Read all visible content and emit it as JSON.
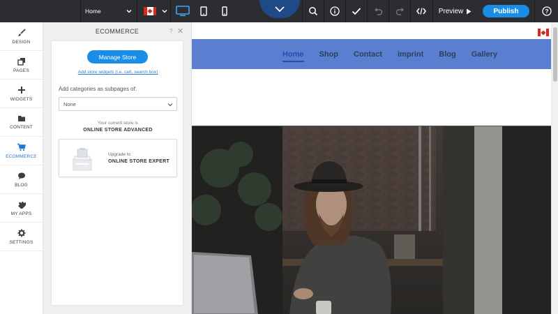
{
  "toolbar": {
    "page_select": "Home",
    "preview_label": "Preview",
    "publish_label": "Publish",
    "colors": {
      "bar": "#2b2d31",
      "accent": "#1a8ee6",
      "notch": "#1f4a86"
    },
    "icons": [
      "desktop-icon",
      "tablet-icon",
      "mobile-icon",
      "chevron-down-icon",
      "search-icon",
      "info-icon",
      "check-icon",
      "undo-icon",
      "redo-icon",
      "code-icon",
      "play-icon",
      "help-icon"
    ]
  },
  "leftnav": {
    "items": [
      {
        "label": "DESIGN",
        "icon": "brush-icon"
      },
      {
        "label": "PAGES",
        "icon": "pages-icon"
      },
      {
        "label": "WIDGETS",
        "icon": "plus-icon"
      },
      {
        "label": "CONTENT",
        "icon": "folder-icon"
      },
      {
        "label": "ECOMMERCE",
        "icon": "cart-icon",
        "active": true
      },
      {
        "label": "BLOG",
        "icon": "chat-icon"
      },
      {
        "label": "MY APPS",
        "icon": "puzzle-icon"
      },
      {
        "label": "SETTINGS",
        "icon": "gear-icon"
      }
    ]
  },
  "panel": {
    "title": "ECOMMERCE",
    "help": "?",
    "close": "✕",
    "manage_store": "Manage Store",
    "add_widgets_link": "Add store widgets (i.e. cart, search box)",
    "add_categories_label": "Add categories as subpages of:",
    "categories_select": "None",
    "current_store_label": "Your current store is",
    "current_store_value": "ONLINE STORE ADVANCED",
    "upgrade_label": "Upgrade to",
    "upgrade_value": "ONLINE STORE EXPERT"
  },
  "site": {
    "nav": [
      "Home",
      "Shop",
      "Contact",
      "imprint",
      "Blog",
      "Gallery"
    ],
    "current_nav": "Home",
    "nav_color": "#5b7fd0"
  }
}
